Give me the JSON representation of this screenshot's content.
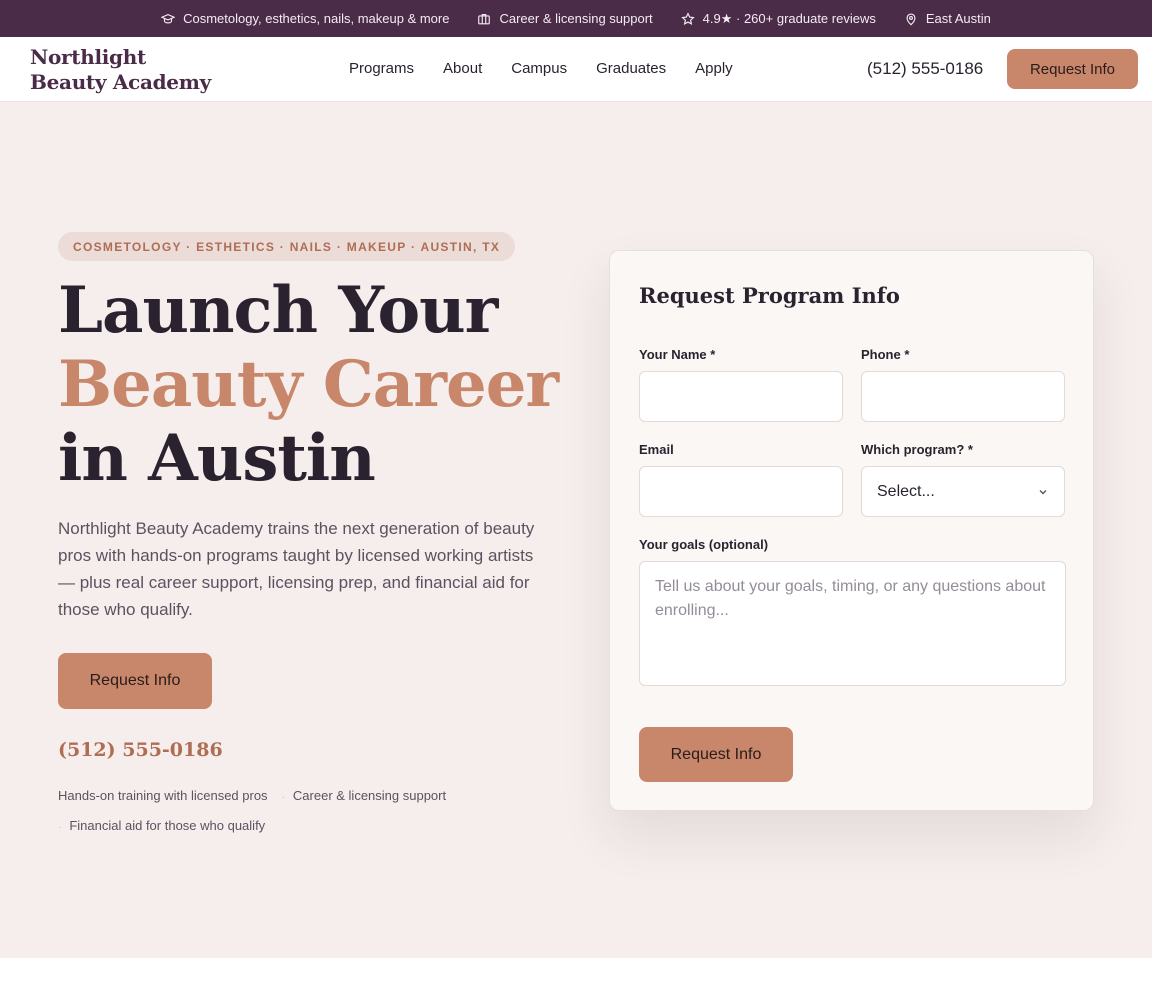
{
  "topbar": {
    "items": [
      {
        "icon": "graduation-cap-icon",
        "text": "Cosmetology, esthetics, nails, makeup & more"
      },
      {
        "icon": "briefcase-icon",
        "text": "Career & licensing support"
      },
      {
        "icon": "star-icon",
        "text": "4.9★ · 260+ graduate reviews"
      },
      {
        "icon": "map-pin-icon",
        "text": "East Austin"
      }
    ]
  },
  "header": {
    "logo_line1": "Northlight",
    "logo_line2": "Beauty Academy",
    "nav": [
      "Programs",
      "About",
      "Campus",
      "Graduates",
      "Apply"
    ],
    "phone": "(512) 555-0186",
    "cta": "Request Info"
  },
  "hero": {
    "pill": "COSMETOLOGY · ESTHETICS · NAILS · MAKEUP · AUSTIN, TX",
    "headline_line1": "Launch Your",
    "headline_line2": "Beauty Career",
    "headline_line3": "in Austin",
    "lead": "Northlight Beauty Academy trains the next generation of beauty pros with hands-on programs taught by licensed working artists — plus real career support, licensing prep, and financial aid for those who qualify.",
    "cta": "Request Info",
    "phone": "(512) 555-0186",
    "features": [
      "Hands-on training with licensed pros",
      "Career & licensing support",
      "Financial aid for those who qualify"
    ]
  },
  "form": {
    "title": "Request Program Info",
    "name_label": "Your Name *",
    "name_value": "",
    "phone_label": "Phone *",
    "phone_value": "",
    "email_label": "Email",
    "email_value": "",
    "program_label": "Which program? *",
    "program_selected": "Select...",
    "goals_label": "Your goals (optional)",
    "goals_placeholder": "Tell us about your goals, timing, or any questions about enrolling...",
    "submit": "Request Info"
  },
  "colors": {
    "brand_plum": "#4a2b48",
    "accent_copper": "#c8876a",
    "hero_bg": "#f5eeec"
  }
}
